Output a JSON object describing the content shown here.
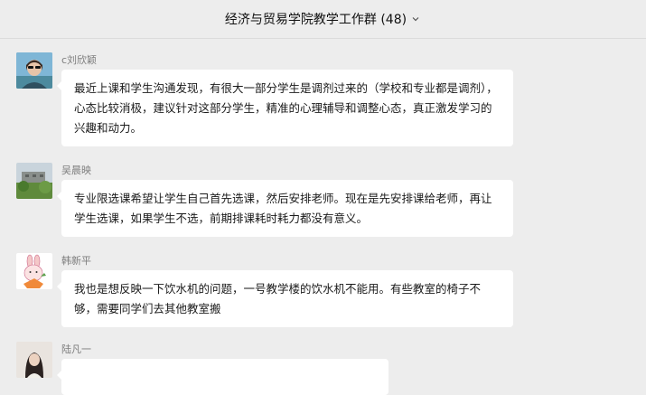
{
  "header": {
    "title": "经济与贸易学院教学工作群 (48)",
    "dropdown_icon": "chevron-down-icon"
  },
  "messages": [
    {
      "sender": "c刘欣颖",
      "avatar": "avatar-woman-sunglasses",
      "text": "最近上课和学生沟通发现，有很大一部分学生是调剂过来的（学校和专业都是调剂），心态比较消极，建议针对这部分学生，精准的心理辅导和调整心态，真正激发学习的兴趣和动力。"
    },
    {
      "sender": "吴晨映",
      "avatar": "avatar-campus-building",
      "text": "专业限选课希望让学生自己首先选课，然后安排老师。现在是先安排课给老师，再让学生选课，如果学生不选，前期排课耗时耗力都没有意义。"
    },
    {
      "sender": "韩新平",
      "avatar": "avatar-cartoon-rabbit",
      "text": "我也是想反映一下饮水机的问题，一号教学楼的饮水机不能用。有些教室的椅子不够，需要同学们去其他教室搬"
    },
    {
      "sender": "陆凡一",
      "avatar": "avatar-woman-portrait",
      "text": ""
    }
  ]
}
